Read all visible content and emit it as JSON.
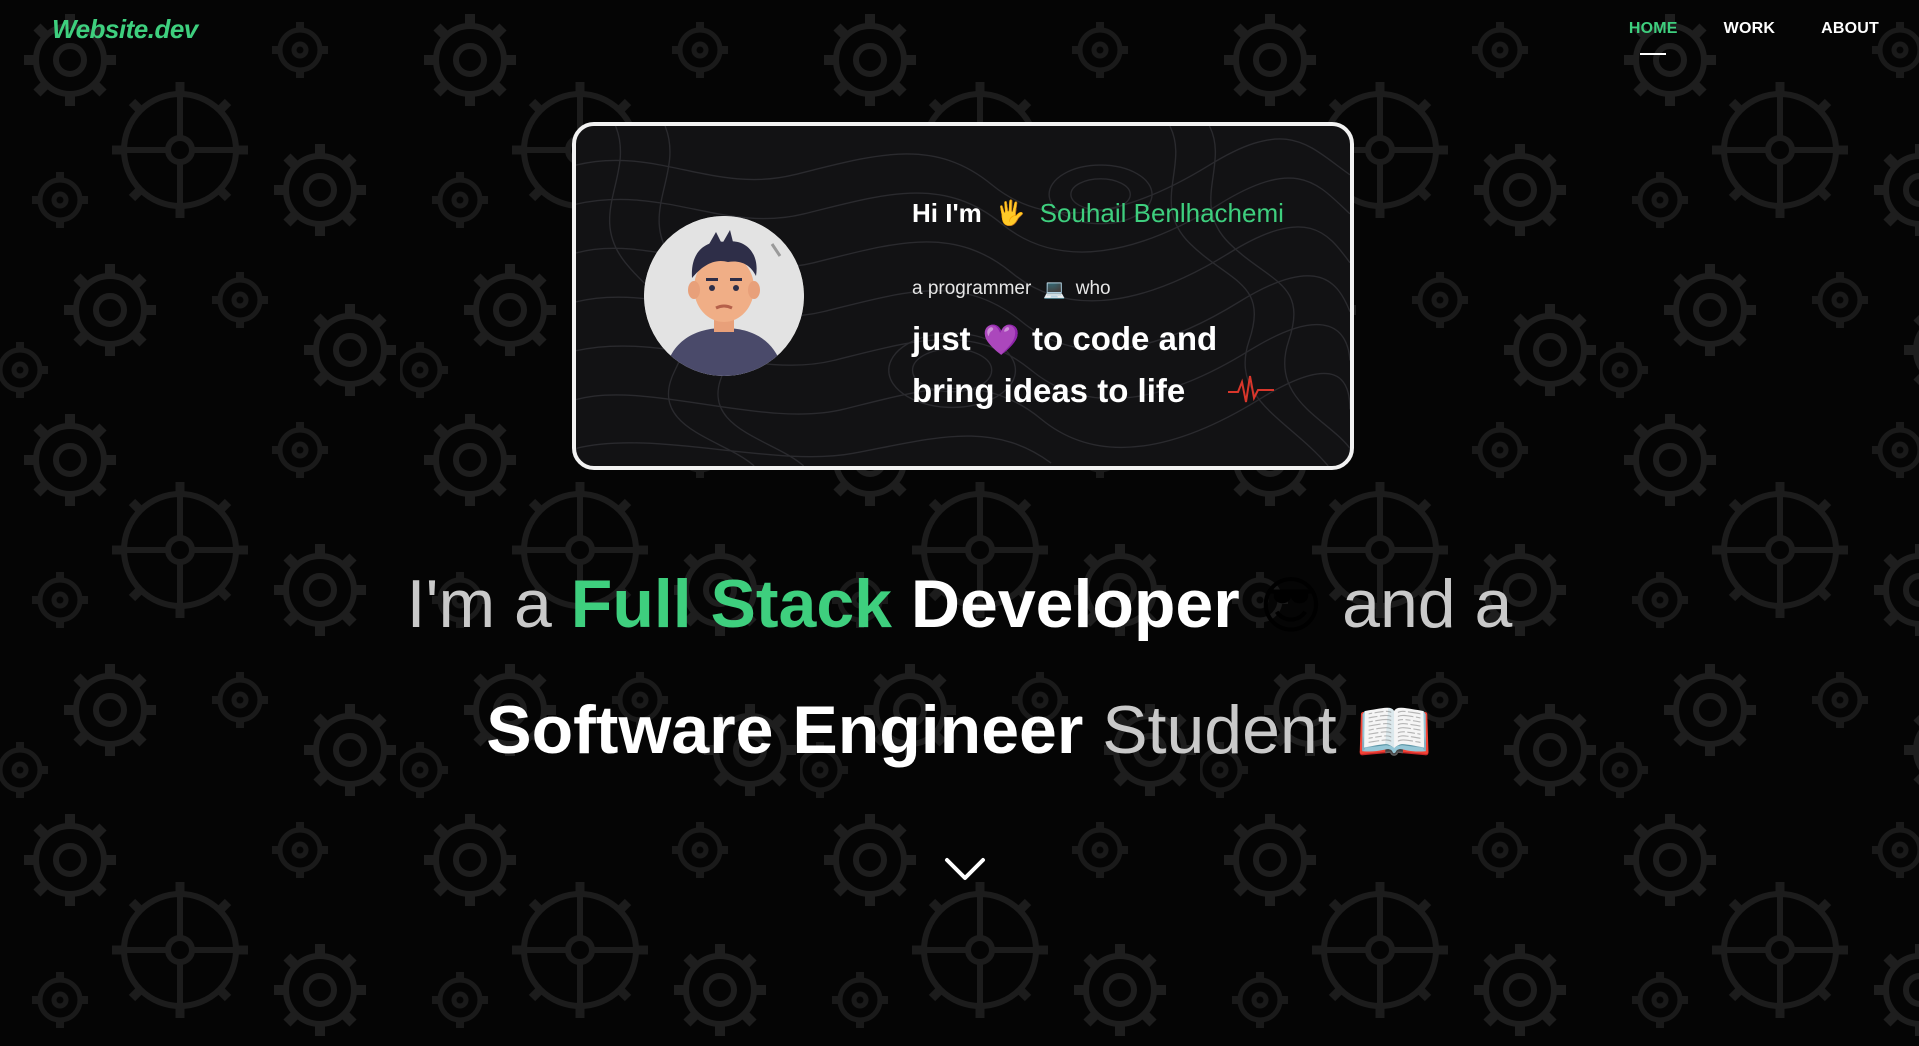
{
  "site": {
    "logo": "Website.dev"
  },
  "nav": {
    "items": [
      {
        "label": "HOME",
        "active": true
      },
      {
        "label": "WORK",
        "active": false
      },
      {
        "label": "ABOUT",
        "active": false
      }
    ]
  },
  "card": {
    "greeting_prefix": "Hi I'm",
    "greeting_emoji": "🖐",
    "name": "Souhail Benlhachemi",
    "tagline_prefix": "a programmer",
    "tagline_emoji": "💻",
    "tagline_suffix": "who",
    "motto_part1": "just",
    "motto_emoji": "💜",
    "motto_part2": "to code and",
    "motto_part3": "bring ideas to life"
  },
  "hero": {
    "line1": {
      "prefix": "I'm a",
      "highlight": "Full Stack",
      "bold": "Developer",
      "emoji": "😎",
      "suffix": "and a"
    },
    "line2": {
      "bold": "Software Engineer",
      "suffix": "Student",
      "emoji": "📖"
    }
  },
  "icons": {
    "scroll": "chevron-down-icon",
    "avatar": "avatar-illustration",
    "heartbeat": "heartbeat-icon",
    "background": "gear-pattern"
  },
  "colors": {
    "accent": "#3ecf7e",
    "background": "#050505",
    "card_border": "#f2f2f2",
    "heartbeat": "#d9362b"
  }
}
